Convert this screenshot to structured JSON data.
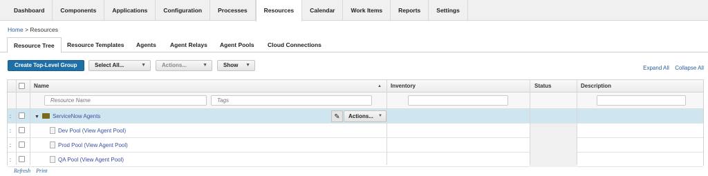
{
  "nav": [
    "Dashboard",
    "Components",
    "Applications",
    "Configuration",
    "Processes",
    "Resources",
    "Calendar",
    "Work Items",
    "Reports",
    "Settings"
  ],
  "breadcrumb": {
    "home": "Home",
    "separator": ">",
    "current": "Resources"
  },
  "subtabs": [
    "Resource Tree",
    "Resource Templates",
    "Agents",
    "Agent Relays",
    "Agent Pools",
    "Cloud Connections"
  ],
  "toolbar": {
    "create_label": "Create Top-Level Group",
    "select_all_label": "Select All...",
    "actions_label": "Actions...",
    "show_label": "Show",
    "expand_all": "Expand All",
    "collapse_all": "Collapse All"
  },
  "table": {
    "headers": {
      "name": "Name",
      "inventory": "Inventory",
      "status": "Status",
      "description": "Description"
    },
    "filters": {
      "resource_name_placeholder": "Resource Name",
      "tags_placeholder": "Tags"
    },
    "group_row": {
      "name": "ServiceNow Agents",
      "actions_label": "Actions..."
    },
    "rows": [
      {
        "name": "Dev Pool",
        "link": "(View Agent Pool)"
      },
      {
        "name": "Prod Pool",
        "link": "(View Agent Pool)"
      },
      {
        "name": "QA Pool",
        "link": "(View Agent Pool)"
      }
    ]
  },
  "footer": {
    "refresh": "Refresh",
    "print": "Print"
  },
  "icons": {
    "drag": "drag-handle-icon",
    "folder": "folder-icon",
    "pool": "agent-pool-icon",
    "edit": "pencil-icon",
    "expand": "triangle-down-icon",
    "sort": "sort-up-icon"
  }
}
